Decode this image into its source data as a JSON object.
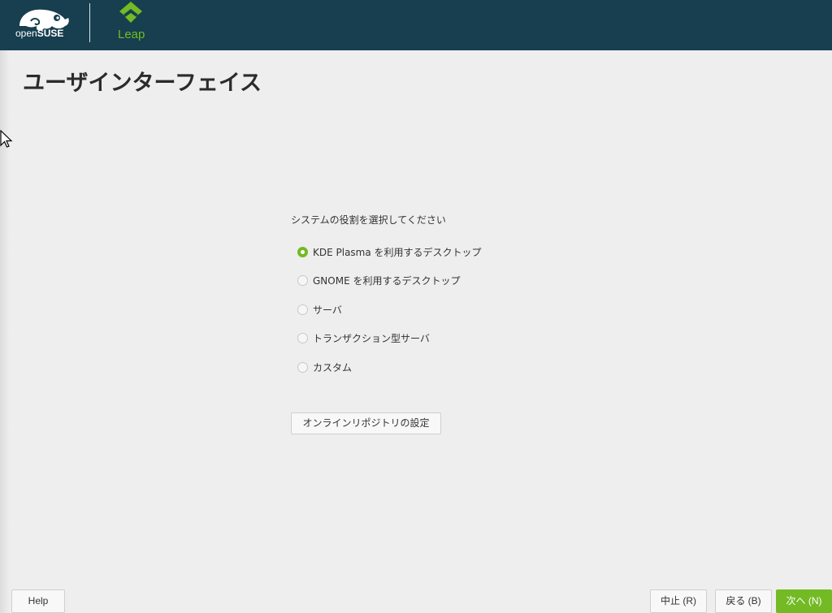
{
  "header": {
    "brand_name_prefix": "open",
    "brand_name_suffix": "SUSE",
    "product_name": "Leap"
  },
  "page": {
    "title": "ユーザインターフェイス"
  },
  "roles": {
    "prompt": "システムの役割を選択してください",
    "items": [
      {
        "label": "KDE Plasma を利用するデスクトップ",
        "selected": true
      },
      {
        "label": "GNOME を利用するデスクトップ",
        "selected": false
      },
      {
        "label": "サーバ",
        "selected": false
      },
      {
        "label": "トランザクション型サーバ",
        "selected": false
      },
      {
        "label": "カスタム",
        "selected": false
      }
    ]
  },
  "actions": {
    "online_repos": "オンラインリポジトリの設定"
  },
  "footer": {
    "help": "Help",
    "abort": "中止 (R)",
    "back": "戻る (B)",
    "next": "次へ (N)"
  },
  "colors": {
    "header_bg": "#173f4f",
    "accent_green": "#73ba25",
    "page_bg": "#eeeeee"
  }
}
